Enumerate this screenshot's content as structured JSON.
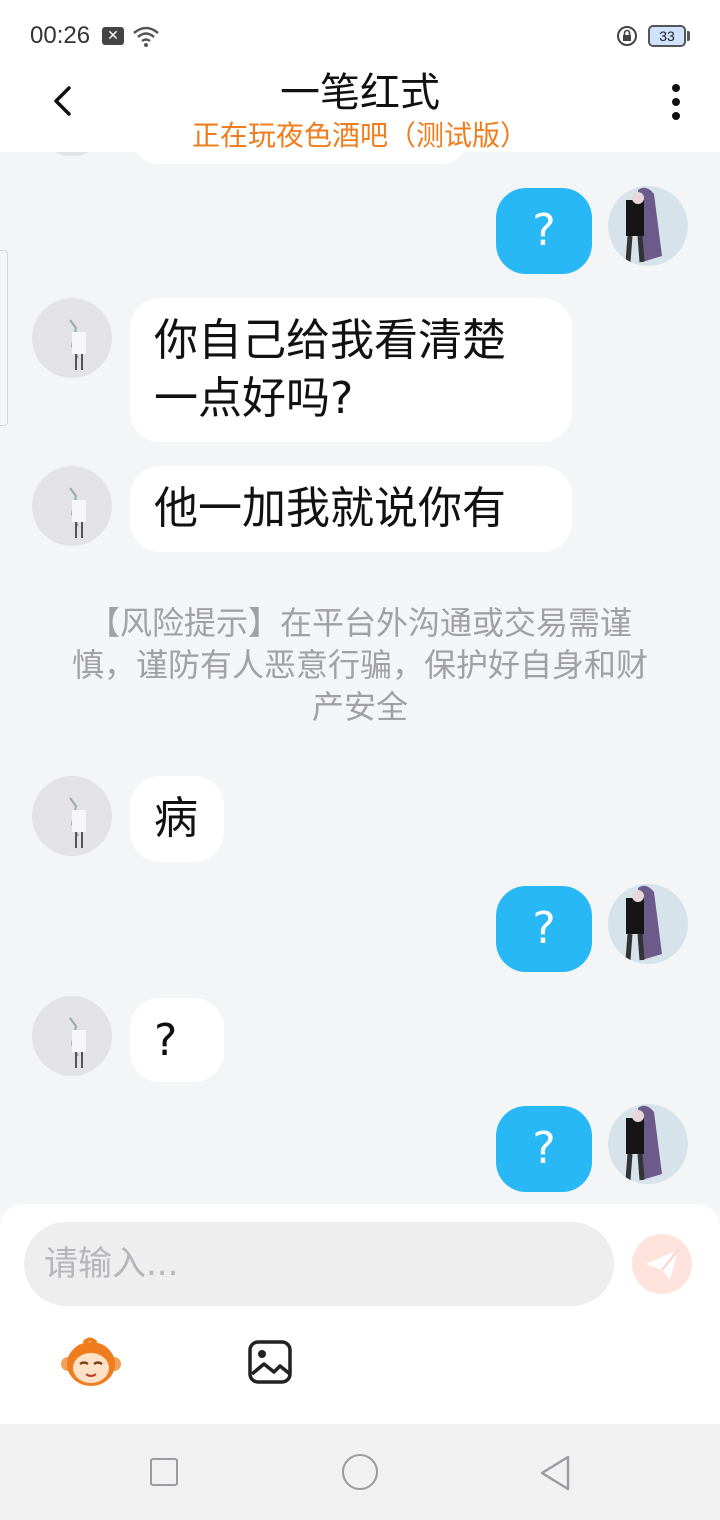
{
  "status_bar": {
    "time": "00:26",
    "notification_icon": "x-icon",
    "battery": "33"
  },
  "header": {
    "title": "一笔红式",
    "subtitle": "正在玩夜色酒吧（测试版）",
    "back_icon": "chevron-left-icon",
    "more_icon": "more-vertical-icon"
  },
  "messages": [
    {
      "sender": "self",
      "text": "?"
    },
    {
      "sender": "other",
      "text": "你自己给我看清楚\n一点好吗?"
    },
    {
      "sender": "other",
      "text": "他一加我就说你有"
    },
    {
      "sender": "system",
      "text": "【风险提示】在平台外沟通或交易需谨慎，谨防有人恶意行骗，保护好自身和财产安全"
    },
    {
      "sender": "other",
      "text": "病"
    },
    {
      "sender": "self",
      "text": "?"
    },
    {
      "sender": "other",
      "text": "?"
    },
    {
      "sender": "self",
      "text": "?"
    }
  ],
  "input": {
    "placeholder": "请输入...",
    "value": ""
  },
  "toolbar": {
    "emoji_icon": "monkey-emoji-icon",
    "image_icon": "image-icon",
    "send_icon": "send-icon"
  },
  "colors": {
    "accent_orange": "#f07d1d",
    "self_bubble": "#28b8f6",
    "background": "#f4f5f7"
  }
}
